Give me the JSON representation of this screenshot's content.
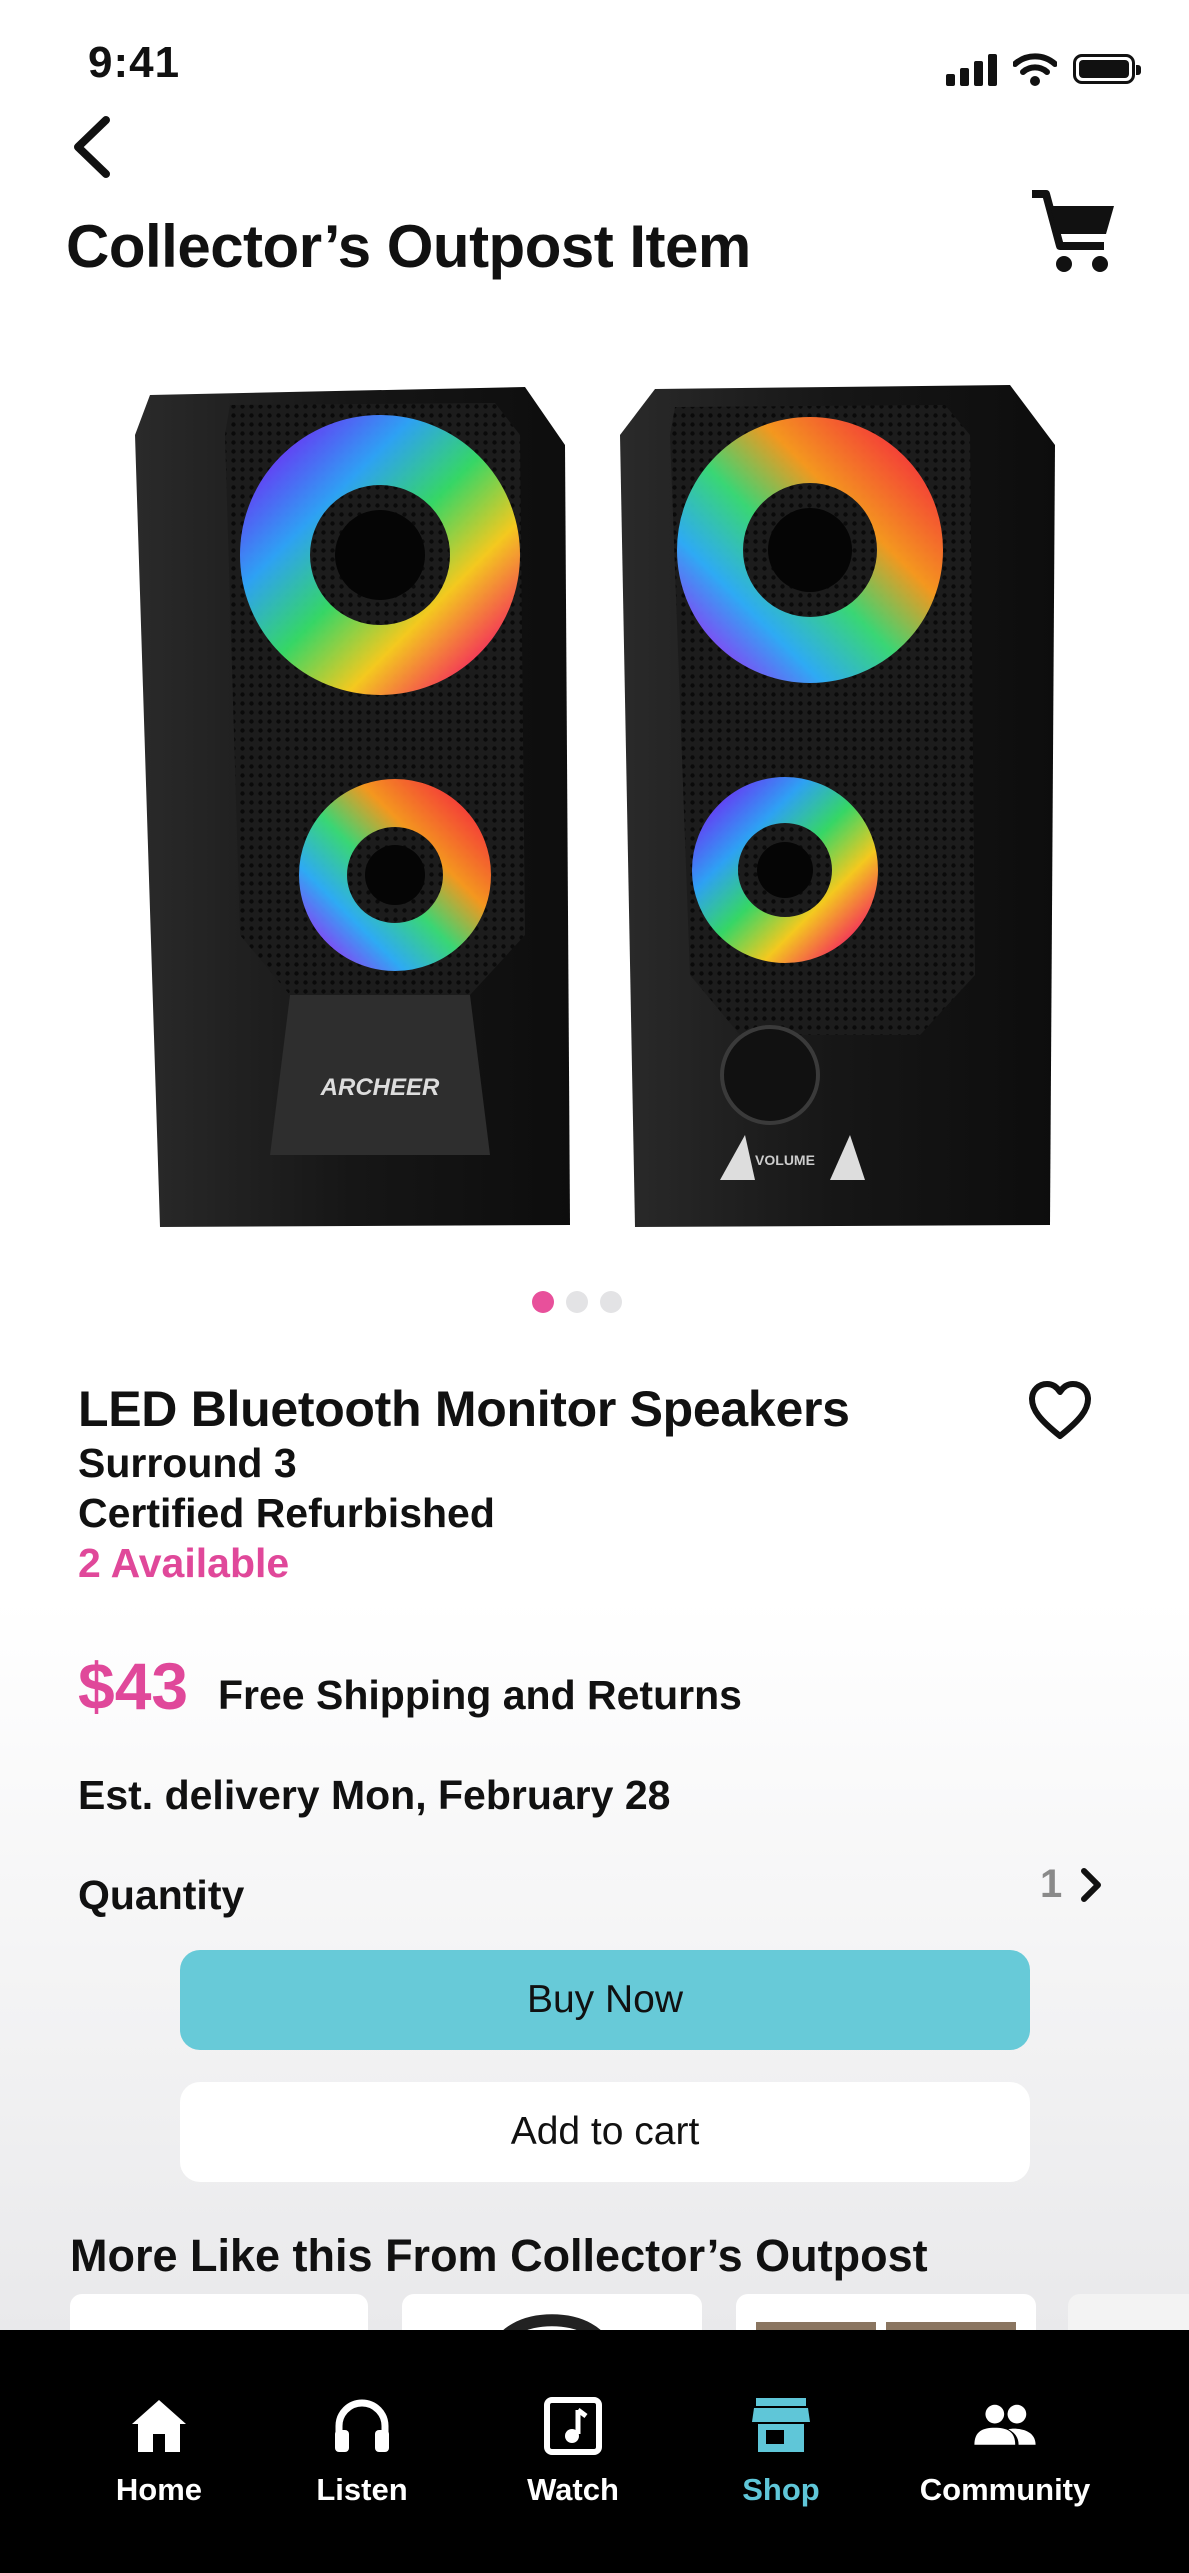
{
  "status_bar": {
    "time": "9:41"
  },
  "header": {
    "title": "Collector’s Outpost Item"
  },
  "product": {
    "brand_mark": "ARCHEER",
    "knob_label": "VOLUME",
    "name": "LED Bluetooth Monitor Speakers",
    "model": "Surround 3",
    "condition": "Certified Refurbished",
    "availability": "2 Available",
    "price": "$43",
    "shipping": "Free Shipping and Returns",
    "delivery": "Est. delivery Mon, February 28",
    "quantity_label": "Quantity",
    "quantity_value": "1",
    "image_count": 3,
    "active_image_index": 0
  },
  "actions": {
    "buy_now": "Buy Now",
    "add_to_cart": "Add to cart"
  },
  "more_section": {
    "title": "More Like this From Collector’s Outpost"
  },
  "tabs": [
    {
      "label": "Home",
      "icon": "home-icon",
      "active": false
    },
    {
      "label": "Listen",
      "icon": "headphones-icon",
      "active": false
    },
    {
      "label": "Watch",
      "icon": "music-note-icon",
      "active": false
    },
    {
      "label": "Shop",
      "icon": "store-icon",
      "active": true
    },
    {
      "label": "Community",
      "icon": "people-icon",
      "active": false
    }
  ],
  "colors": {
    "accent_pink": "#e0489a",
    "accent_teal": "#67cad8",
    "tabbar_bg": "#000000"
  }
}
